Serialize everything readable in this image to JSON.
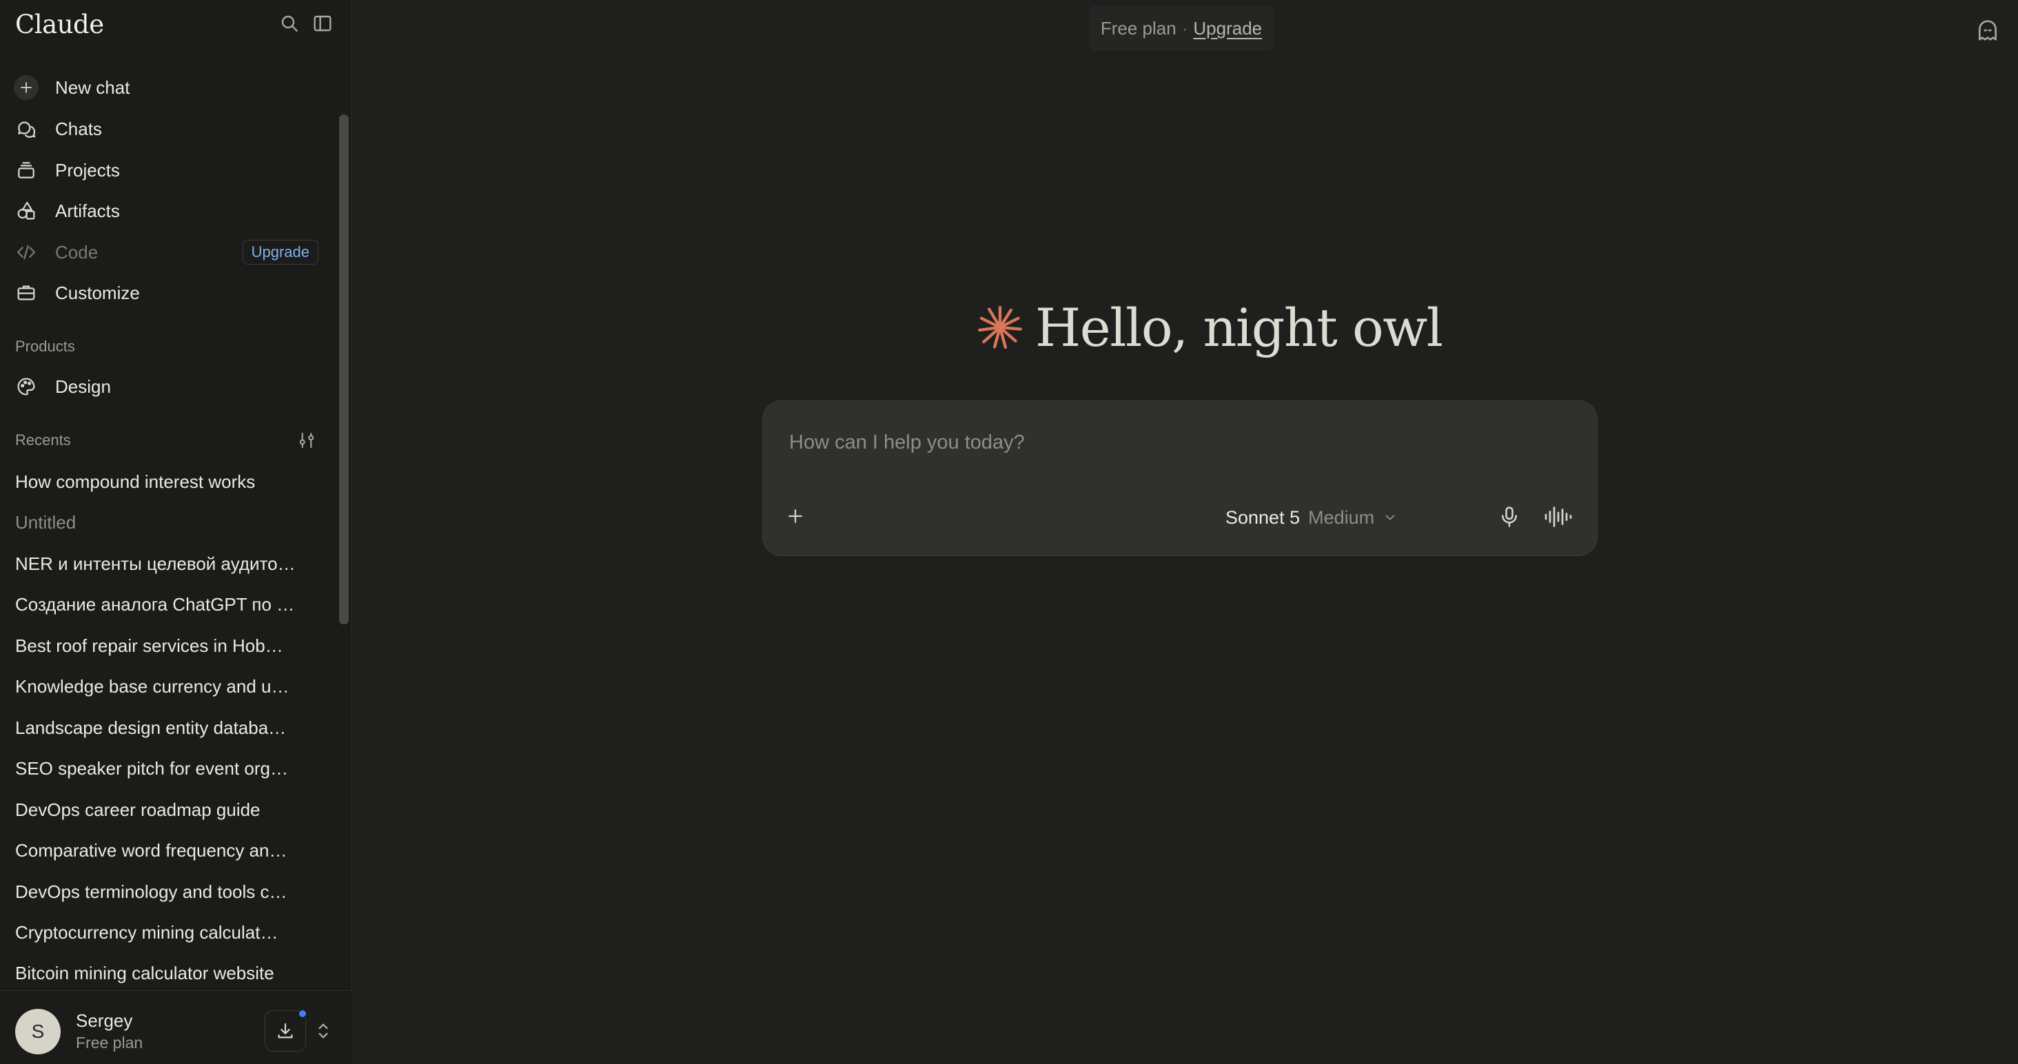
{
  "app": {
    "logo": "Claude"
  },
  "sidebar": {
    "new_chat": "New chat",
    "nav": [
      {
        "label": "Chats",
        "icon": "chats-icon"
      },
      {
        "label": "Projects",
        "icon": "projects-icon"
      },
      {
        "label": "Artifacts",
        "icon": "artifacts-icon"
      },
      {
        "label": "Code",
        "icon": "code-icon",
        "badge": "Upgrade"
      },
      {
        "label": "Customize",
        "icon": "customize-icon"
      }
    ],
    "products_label": "Products",
    "products": [
      {
        "label": "Design",
        "icon": "palette-icon"
      }
    ],
    "recents_label": "Recents",
    "recents": [
      "How compound interest works",
      "Untitled",
      "NER и интенты целевой аудито…",
      "Создание аналога ChatGPT по …",
      "Best roof repair services in Hob…",
      "Knowledge base currency and u…",
      "Landscape design entity databa…",
      "SEO speaker pitch for event org…",
      "DevOps career roadmap guide",
      "Comparative word frequency an…",
      "DevOps terminology and tools c…",
      "Cryptocurrency mining calculat…",
      "Bitcoin mining calculator website"
    ],
    "user": {
      "initial": "S",
      "name": "Sergey",
      "plan": "Free plan"
    }
  },
  "banner": {
    "plan": "Free plan",
    "separator": "·",
    "upgrade": "Upgrade"
  },
  "main": {
    "greeting": "Hello, night owl",
    "composer": {
      "placeholder": "How can I help you today?",
      "value": "",
      "model": "Sonnet 5",
      "effort": "Medium"
    }
  },
  "colors": {
    "background": "#1f1f1e",
    "sidebar": "#1b1b1a",
    "composer": "#30302e",
    "accent": "#d97757",
    "link": "#7fb0ee",
    "notification": "#3b82f6"
  }
}
